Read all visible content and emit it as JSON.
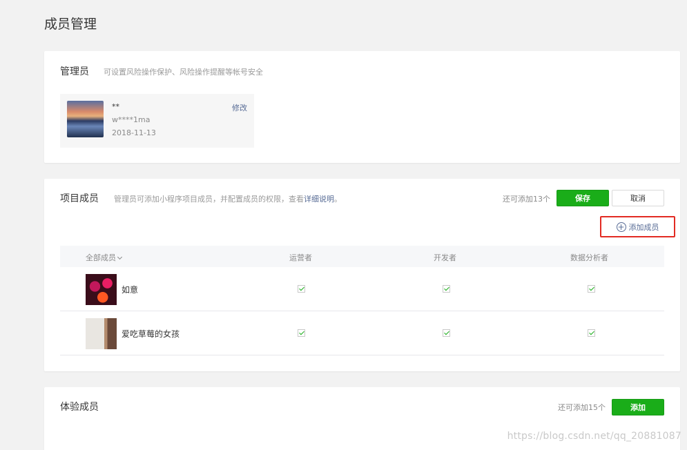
{
  "page_title": "成员管理",
  "admin": {
    "title": "管理员",
    "desc": "可设置风险操作保护、风险操作提醒等帐号安全",
    "name": "**",
    "id": "w****1ma",
    "date": "2018-11-13",
    "edit_label": "修改"
  },
  "members": {
    "title": "项目成员",
    "desc_prefix": "管理员可添加小程序项目成员，并配置成员的权限，查看",
    "desc_link": "详细说明",
    "desc_suffix": "。",
    "quota": "还可添加13个",
    "save_label": "保存",
    "cancel_label": "取消",
    "add_label": "添加成员",
    "columns": [
      "全部成员",
      "运营者",
      "开发者",
      "数据分析者"
    ],
    "rows": [
      {
        "name": "如意",
        "operator": true,
        "developer": true,
        "analyst": true
      },
      {
        "name": "爱吃草莓的女孩",
        "operator": true,
        "developer": true,
        "analyst": true
      }
    ]
  },
  "testers": {
    "title": "体验成员",
    "quota": "还可添加15个",
    "add_label": "添加"
  },
  "watermark": "https://blog.csdn.net/qq_20881087",
  "colors": {
    "primary": "#1aad19",
    "link": "#576b95",
    "highlight": "#e22a22"
  }
}
